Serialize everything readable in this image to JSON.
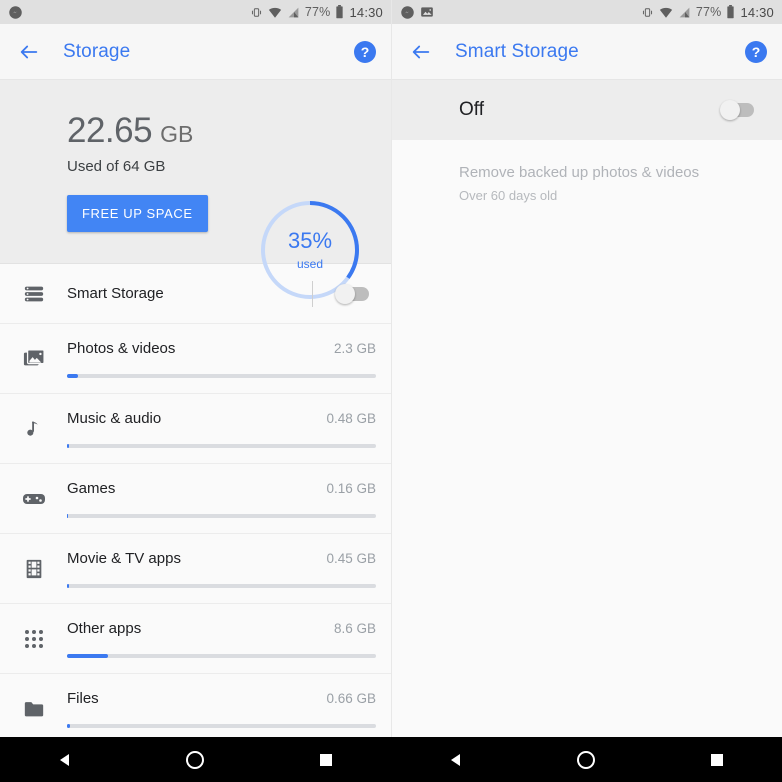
{
  "left": {
    "status_bar": {
      "icons": [
        "messenger-icon"
      ],
      "vibrate_icon": "vibrate-icon",
      "wifi_icon": "wifi-icon",
      "signal_icon": "cellular-signal-icon",
      "battery_percent": "77%",
      "battery_icon": "battery-icon",
      "time": "14:30"
    },
    "appbar": {
      "back_icon": "back-arrow-icon",
      "title": "Storage",
      "help_icon": "help-icon"
    },
    "summary": {
      "used_number": "22.65",
      "used_unit": "GB",
      "used_of": "Used of 64 GB",
      "free_button": "FREE UP SPACE",
      "gauge_percent": "35%",
      "gauge_sub": "used",
      "gauge_value": 35,
      "accent_color": "#4285f4"
    },
    "smart_storage_row": {
      "icon": "storage-list-icon",
      "label": "Smart Storage",
      "toggle_state": "off"
    },
    "categories": [
      {
        "icon": "photos-icon",
        "name": "Photos & videos",
        "size": "2.3 GB",
        "fill_percent": 3.6
      },
      {
        "icon": "music-icon",
        "name": "Music & audio",
        "size": "0.48 GB",
        "fill_percent": 0.75
      },
      {
        "icon": "games-icon",
        "name": "Games",
        "size": "0.16 GB",
        "fill_percent": 0.25
      },
      {
        "icon": "movies-icon",
        "name": "Movie & TV apps",
        "size": "0.45 GB",
        "fill_percent": 0.7
      },
      {
        "icon": "apps-grid-icon",
        "name": "Other apps",
        "size": "8.6 GB",
        "fill_percent": 13.4
      },
      {
        "icon": "folder-icon",
        "name": "Files",
        "size": "0.66 GB",
        "fill_percent": 1.0
      }
    ]
  },
  "right": {
    "status_bar": {
      "icons": [
        "messenger-icon",
        "screenshot-icon"
      ],
      "vibrate_icon": "vibrate-icon",
      "wifi_icon": "wifi-icon",
      "signal_icon": "cellular-signal-icon",
      "battery_percent": "77%",
      "battery_icon": "battery-icon",
      "time": "14:30"
    },
    "appbar": {
      "back_icon": "back-arrow-icon",
      "title": "Smart Storage",
      "help_icon": "help-icon"
    },
    "master_switch": {
      "label": "Off",
      "toggle_state": "off"
    },
    "option": {
      "title": "Remove backed up photos & videos",
      "subtitle": "Over 60 days old"
    }
  },
  "navbar": {
    "back": "nav-back-icon",
    "home": "nav-home-icon",
    "recents": "nav-recents-icon"
  }
}
